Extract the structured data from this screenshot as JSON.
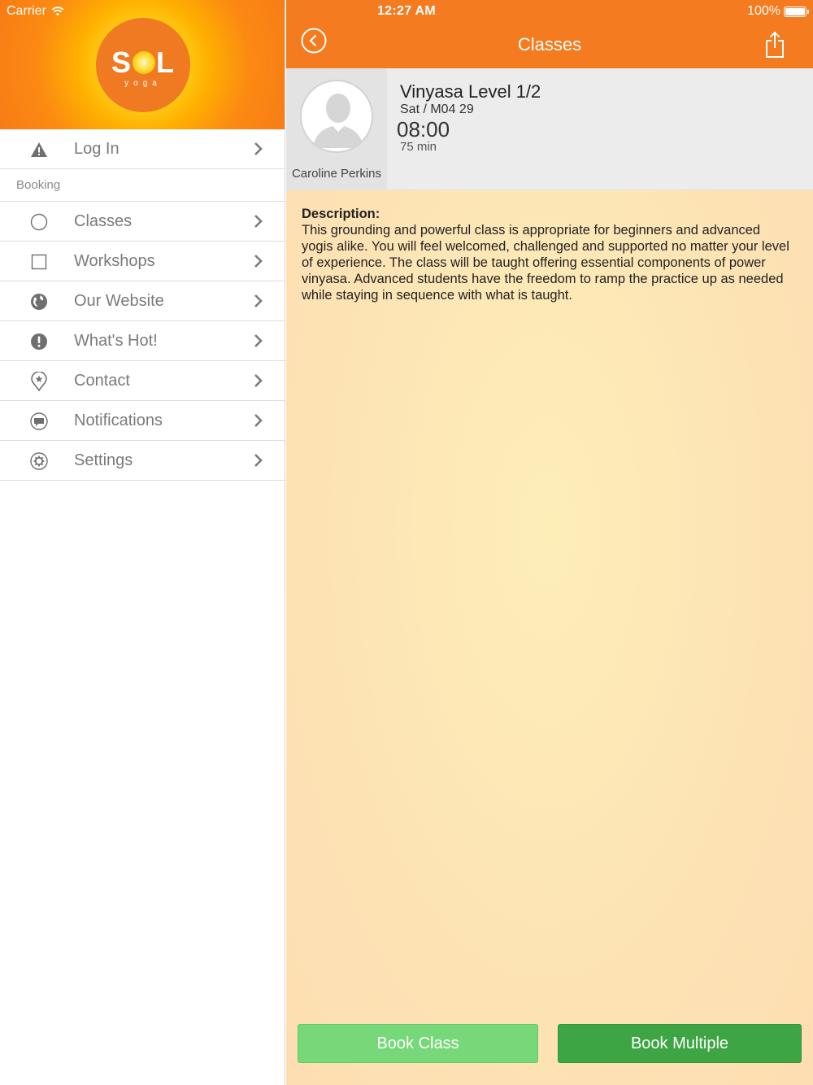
{
  "status_bar": {
    "carrier": "Carrier",
    "time": "12:27 AM",
    "battery": "100%"
  },
  "sidebar": {
    "logo": {
      "text_s": "S",
      "text_l": "L",
      "sub": "yoga"
    },
    "login_label": "Log In",
    "section_label": "Booking",
    "items": [
      {
        "label": "Classes",
        "icon": "circle-icon"
      },
      {
        "label": "Workshops",
        "icon": "square-icon"
      },
      {
        "label": "Our Website",
        "icon": "globe-icon"
      },
      {
        "label": "What's Hot!",
        "icon": "exclamation-icon"
      },
      {
        "label": "Contact",
        "icon": "location-pin-icon"
      },
      {
        "label": "Notifications",
        "icon": "chat-bubble-icon"
      },
      {
        "label": "Settings",
        "icon": "gear-icon"
      }
    ]
  },
  "nav": {
    "title": "Classes"
  },
  "class": {
    "title": "Vinyasa Level 1/2",
    "date": "Sat / M04 29",
    "time": "08:00",
    "duration": "75 min",
    "instructor": "Caroline Perkins"
  },
  "description": {
    "heading": "Description:",
    "body": "This grounding and powerful class is appropriate for beginners and advanced yogis alike.  You will feel welcomed, challenged and supported no matter your level of experience.  The class will be taught offering essential components of power vinyasa.  Advanced students have the freedom to ramp the practice up as needed while staying in sequence with what is taught."
  },
  "buttons": {
    "book_class": "Book Class",
    "book_multiple": "Book Multiple"
  },
  "colors": {
    "accent": "#f47b20",
    "book_class": "#76d878",
    "book_multiple": "#3da543"
  }
}
